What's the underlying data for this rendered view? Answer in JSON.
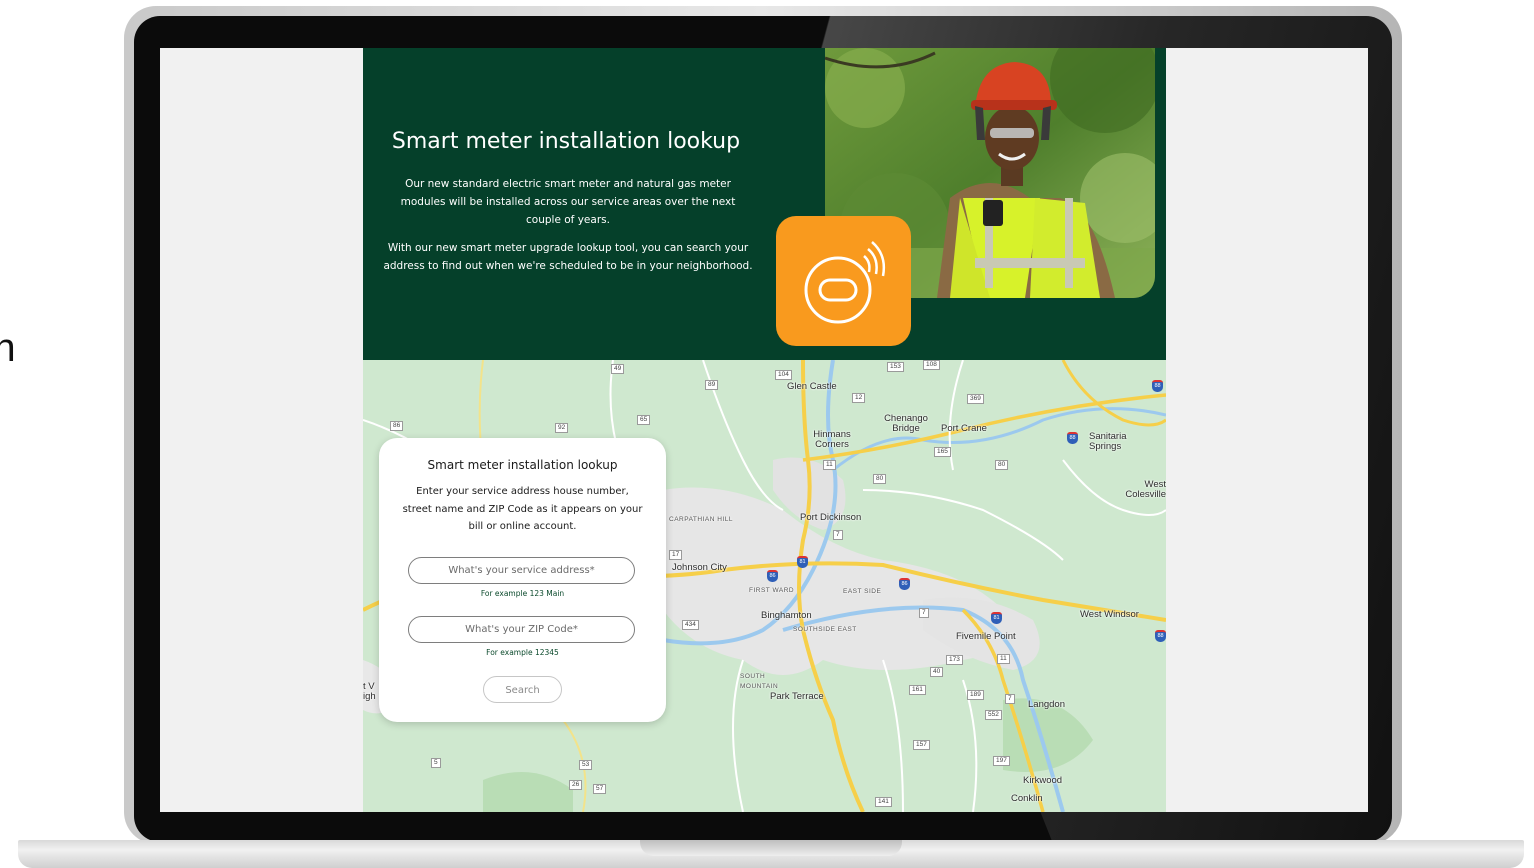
{
  "edge_text": "rch",
  "hero": {
    "title": "Smart meter installation lookup",
    "paragraph1": "Our new standard electric smart meter and natural gas meter modules will be installed across our service areas over the next couple of years.",
    "paragraph2": "With our new smart meter upgrade lookup tool, you can search your address to find out when we're scheduled to be in your neighborhood."
  },
  "lookup": {
    "title": "Smart meter installation lookup",
    "description": "Enter your service address house number, street name and ZIP Code as it appears on your bill or online account.",
    "address_placeholder": "What's your service address*",
    "address_hint": "For example 123 Main",
    "zip_placeholder": "What's your ZIP Code*",
    "zip_hint": "For example 12345",
    "search_label": "Search"
  },
  "map": {
    "places": {
      "glen_castle": "Glen Castle",
      "chenango_bridge": "Chenango Bridge",
      "port_crane": "Port Crane",
      "sanitaria_springs": "Sanitaria Springs",
      "hinmans_corners": "Hinmans Corners",
      "west_colesville": "West Colesville",
      "port_dickinson": "Port Dickinson",
      "carpathian_hill": "CARPATHIAN HILL",
      "johnson_city": "Johnson City",
      "first_ward": "FIRST WARD",
      "east_side": "EAST SIDE",
      "binghamton": "Binghamton",
      "southside_east": "SOUTHSIDE EAST",
      "west_windsor": "West Windsor",
      "fivemile_point": "Fivemile Point",
      "south_mountain": "SOUTH MOUNTAIN",
      "park_terrace": "Park Terrace",
      "langdon": "Langdon",
      "kirkwood": "Kirkwood",
      "conklin": "Conklin",
      "edge_left": "t V igh"
    },
    "route_shields": [
      "49",
      "89",
      "104",
      "153",
      "108",
      "86",
      "92",
      "65",
      "12",
      "369",
      "165",
      "80",
      "11",
      "80",
      "7",
      "17",
      "434",
      "7",
      "173",
      "40",
      "11",
      "161",
      "189",
      "552",
      "7",
      "157",
      "197",
      "5",
      "53",
      "26",
      "57",
      "141"
    ],
    "interstates": [
      "88",
      "88",
      "81",
      "86",
      "86",
      "81",
      "88"
    ]
  },
  "colors": {
    "hero_bg": "#05402a",
    "badge": "#f99a1e",
    "map_green": "#cfe8cf",
    "road_yellow": "#f6cf49",
    "river": "#9cc9ee"
  }
}
